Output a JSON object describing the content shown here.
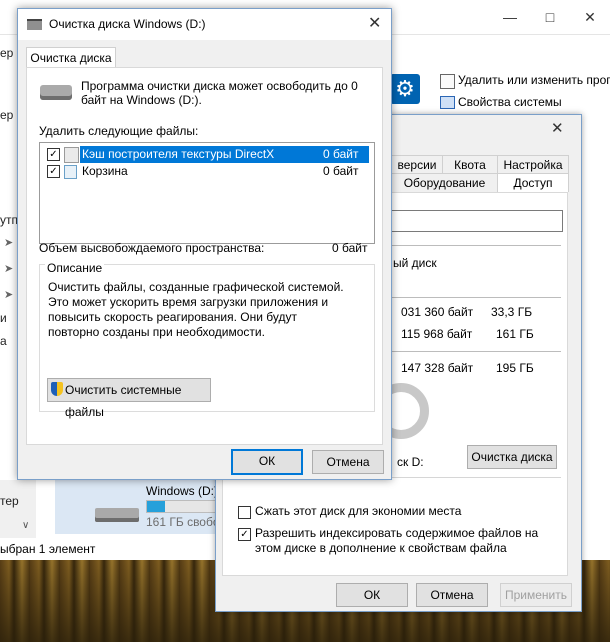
{
  "explorer": {
    "ribbon_uninstall": "Удалить или изменить прогр",
    "ribbon_sysprops": "Свойства системы",
    "left_fragments": [
      "ер",
      "ер",
      "утп",
      "и",
      "а"
    ],
    "nav_footer": "тер",
    "drive_name": "Windows (D:)",
    "drive_free": "161 ГБ свобо",
    "status": "ыбран 1 элемент"
  },
  "properties": {
    "tabs_top": [
      "версии",
      "Квота",
      "Настройка"
    ],
    "tabs_bottom": [
      "Оборудование",
      "Доступ"
    ],
    "local_disk_label": "ый диск",
    "used_bytes": "031 360 байт",
    "used_gb": "33,3 ГБ",
    "free_bytes": "115 968 байт",
    "free_gb": "161 ГБ",
    "total_bytes": "147 328 байт",
    "total_gb": "195 ГБ",
    "disk_caption": "ск D:",
    "cleanup_button": "Очистка диска",
    "compress_label": "Сжать этот диск для экономии места",
    "index_label": "Разрешить индексировать содержимое файлов на этом диске в дополнение к свойствам файла",
    "ok": "ОК",
    "cancel": "Отмена",
    "apply": "Применить"
  },
  "cleanup": {
    "title": "Очистка диска Windows (D:)",
    "tab": "Очистка диска",
    "intro": "Программа очистки диска может освободить до 0 байт на Windows (D:).",
    "delete_label": "Удалить следующие файлы:",
    "files": [
      {
        "name": "Кэш построителя текстуры DirectX",
        "size": "0 байт",
        "checked": true,
        "selected": true
      },
      {
        "name": "Корзина",
        "size": "0 байт",
        "checked": true,
        "selected": false
      }
    ],
    "space_label": "Объем высвобождаемого пространства:",
    "space_value": "0 байт",
    "description_label": "Описание",
    "description": "Очистить файлы, созданные графической системой. Это может ускорить время загрузки приложения и повысить скорость реагирования. Они будут повторно созданы при необходимости.",
    "system_files_button": "Очистить системные файлы",
    "ok": "ОК",
    "cancel": "Отмена"
  },
  "colors": {
    "accent": "#0078d7",
    "selection": "#0078d7",
    "progress": "#26a0da"
  }
}
